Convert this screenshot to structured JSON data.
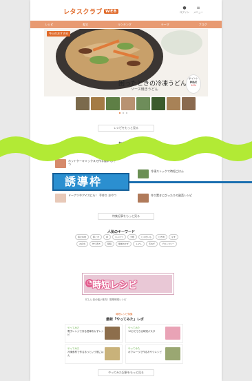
{
  "header": {
    "logo_text": "レタスクラブ",
    "logo_badge": "WEB",
    "icons": [
      {
        "name": "user-icon",
        "glyph": "●",
        "label": "ログイン"
      },
      {
        "name": "menu-icon",
        "glyph": "≡",
        "label": "メニュー"
      }
    ]
  },
  "nav": {
    "items": [
      "レシピ",
      "献立",
      "ランキング",
      "テーマ",
      "ブログ"
    ]
  },
  "hero": {
    "sticker": "今日のおすすめ",
    "title": "困ったときの冷凍うどん",
    "subtitle": "ソース焼きうどん",
    "promo_text": [
      "ポイント",
      "MAX",
      "10%"
    ],
    "food_colors": [
      "#3b3633",
      "#c8a06a",
      "#7aa14b",
      "#e07b3a"
    ]
  },
  "thumbnails": {
    "colors": [
      "#7b6a4c",
      "#a47b45",
      "#5e7f45",
      "#b89272",
      "#6e8d5a",
      "#3b5b2c",
      "#a88257",
      "#8a6a4f"
    ]
  },
  "buttons": {
    "more_recipes": "レシピをもっと見る",
    "more_articles": "特集記事をもっと見る",
    "more_jitan": "やってみた記事をもっと見る"
  },
  "guide": {
    "label": "誘導枠"
  },
  "articles": {
    "header": "おすすめ",
    "items": [
      {
        "text": "ホットケーキミックスで作る簡単 おやつ",
        "color": "#d68a6b"
      },
      {
        "text": "冷凍ストックで時短ごはん",
        "color": "#6b8f54"
      },
      {
        "text": "ドーナツやアイスにも！ 手作り おやつ",
        "color": "#e8c9b8"
      },
      {
        "text": "作り置きにぴったりの副菜レシピ",
        "color": "#b07a5a"
      }
    ]
  },
  "keywords": {
    "title": "人気のキーワード",
    "items": [
      "鶏むね肉",
      "豚こま",
      "卵",
      "キャベツ",
      "大根",
      "じゃがいも",
      "ひき肉",
      "なす",
      "お弁当",
      "作り置き",
      "時短",
      "簡単おかず",
      "トマト",
      "玉ねぎ",
      "ブロッコリー"
    ]
  },
  "jitan": {
    "banner_text": "時短レシピ",
    "banner_icon": "◔",
    "caption": "忙しい日の強い味方！簡単時短レシピ",
    "section_label": "時短レシピ特集",
    "section_title": "最新「やってみた」レポ",
    "cards": [
      {
        "label": "やってみた",
        "text": "電子レンジで作る簡単おかずレシピ",
        "color": "#8d6e4c"
      },
      {
        "label": "やってみた",
        "text": "10分でできる時短パスタ",
        "color": "#e9a3b6"
      },
      {
        "label": "やってみた",
        "text": "冷凍食材で作るあっという間ごはん",
        "color": "#c9b27a"
      },
      {
        "label": "やってみた",
        "text": "ボウル一つで作るおやつレシピ",
        "color": "#9aa772"
      }
    ]
  }
}
